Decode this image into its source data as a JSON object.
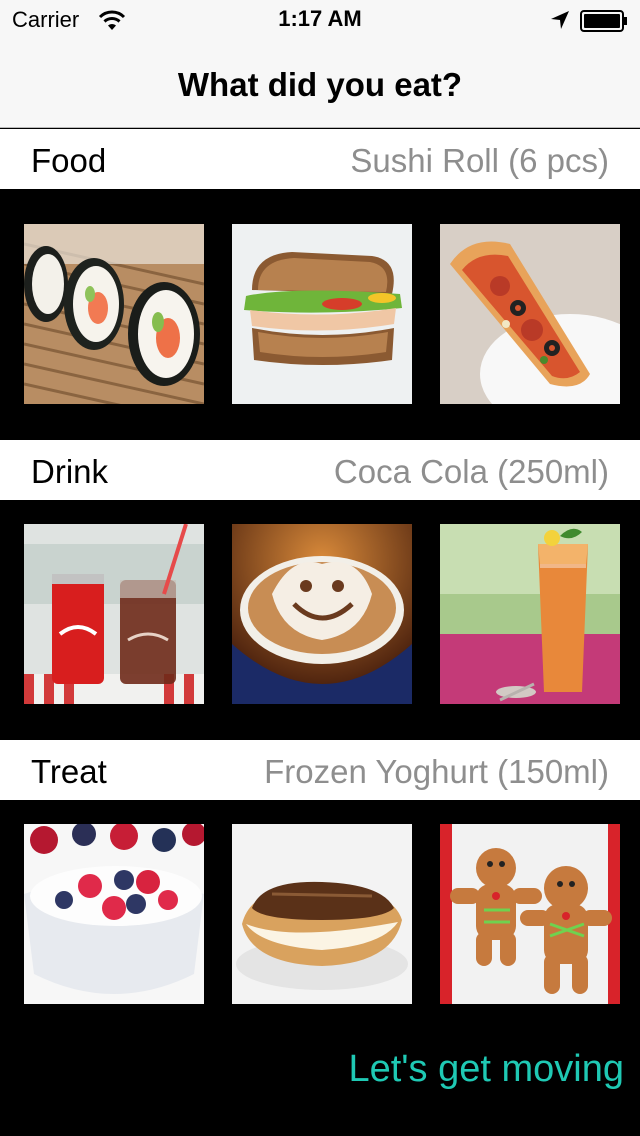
{
  "status_bar": {
    "carrier": "Carrier",
    "time": "1:17 AM",
    "wifi_icon": "wifi-icon",
    "location_icon": "location-arrow-icon",
    "battery_icon": "battery-icon"
  },
  "nav": {
    "title": "What did you eat?"
  },
  "sections": [
    {
      "label": "Food",
      "selected": "Sushi Roll (6 pcs)",
      "items": [
        "sushi-roll",
        "sandwich",
        "pizza-slice"
      ]
    },
    {
      "label": "Drink",
      "selected": "Coca Cola (250ml)",
      "items": [
        "coca-cola",
        "cappuccino",
        "iced-tea"
      ]
    },
    {
      "label": "Treat",
      "selected": "Frozen Yoghurt (150ml)",
      "items": [
        "frozen-yoghurt",
        "eclair",
        "gingerbread-cookies"
      ]
    }
  ],
  "cta": {
    "label": "Let's get moving"
  },
  "colors": {
    "accent": "#1fc9b4",
    "muted_text": "#8e8e8e",
    "bar_background": "#f7f7f7"
  }
}
